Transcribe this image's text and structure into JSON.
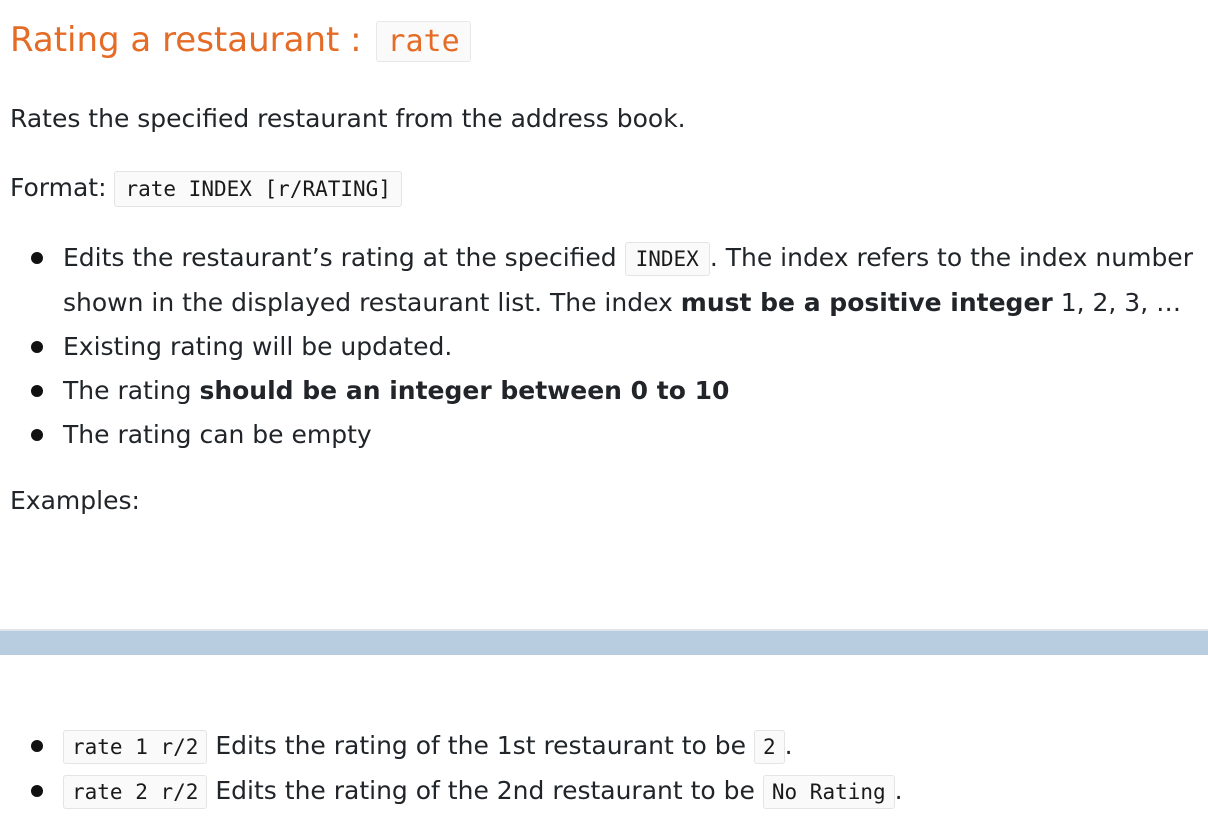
{
  "heading": {
    "text": "Rating a restaurant : ",
    "command": "rate"
  },
  "description": "Rates the specified restaurant from the address book.",
  "format": {
    "label": "Format: ",
    "code": "rate INDEX [r/RATING]"
  },
  "rules": [
    {
      "pre": "Edits the restaurant’s rating at the specified ",
      "code": "INDEX",
      "mid": ". The index refers to the index number",
      "line2_pre": "shown in the displayed restaurant list. The index ",
      "bold": "must be a positive integer",
      "post": " 1, 2, 3, …"
    },
    {
      "text": "Existing rating will be updated."
    },
    {
      "pre": "The rating ",
      "bold": "should be an integer between 0 to 10"
    },
    {
      "text": "The rating can be empty"
    }
  ],
  "examples_label": "Examples:",
  "examples": [
    {
      "code": "rate 1 r/2",
      "text": " Edits the rating of the 1st restaurant to be ",
      "value": "2",
      "end": "."
    },
    {
      "code": "rate 2 r/2",
      "text": " Edits the rating of the 2nd restaurant to be ",
      "value": "No Rating",
      "end": "."
    }
  ],
  "colors": {
    "heading": "#e46c26",
    "band": "#b8cddf"
  }
}
